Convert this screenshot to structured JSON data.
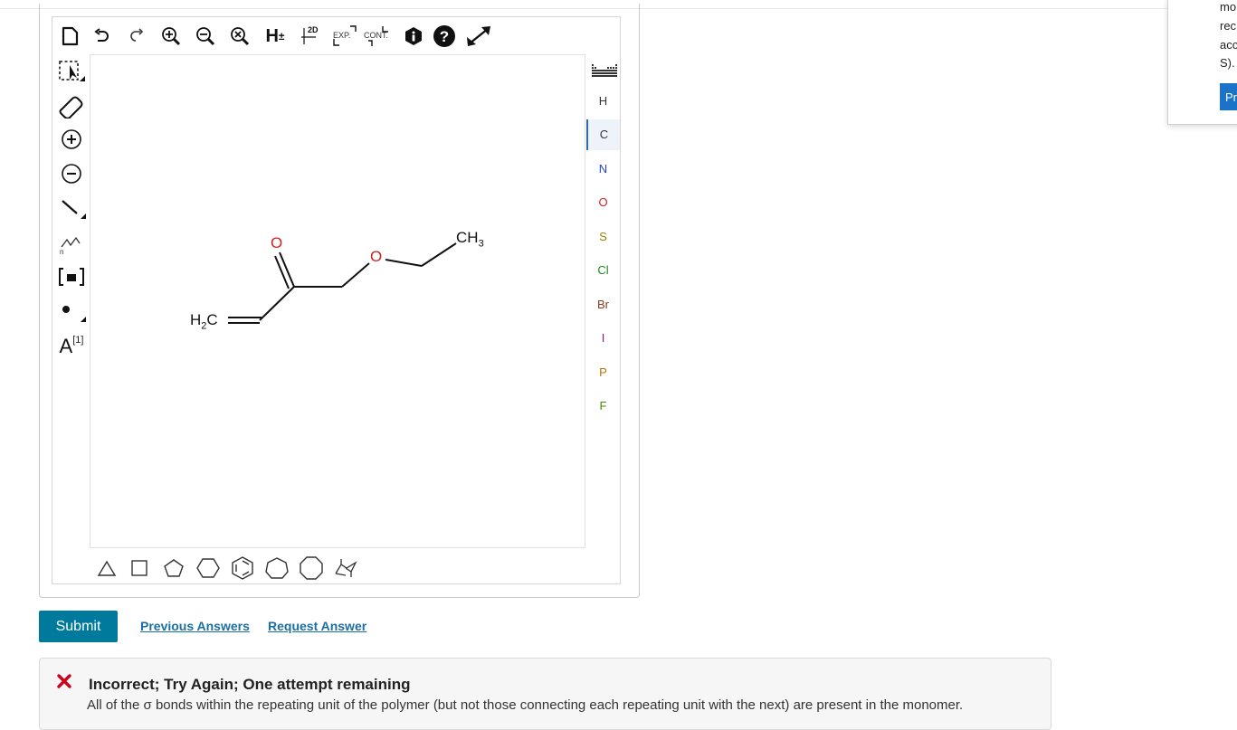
{
  "toolbar_top": {
    "icons": [
      "new-document-icon",
      "undo-icon",
      "redo-icon",
      "zoom-in-icon",
      "zoom-out-icon",
      "zoom-reset-icon",
      "explicit-hydrogens-icon",
      "clean-2d-icon",
      "expand-icon",
      "contract-icon",
      "info-icon",
      "help-icon",
      "fullscreen-icon"
    ],
    "h_label": "H",
    "h_sup": "±",
    "clean_label": "2D",
    "expand_label": "EXP.",
    "contract_label": "CONT."
  },
  "left_tools": {
    "icons": [
      "select-icon",
      "eraser-icon",
      "positive-charge-icon",
      "negative-charge-icon",
      "single-bond-icon",
      "chain-icon",
      "bracket-icon",
      "radical-icon",
      "atom-map-icon"
    ],
    "atom_map_label": "A",
    "atom_map_sup": "[1]"
  },
  "molecule": {
    "oxygen_carbonyl": "O",
    "oxygen_ether": "O",
    "methyl_label": "CH",
    "methyl_sub": "3",
    "vinyl_label": "H",
    "vinyl_sub": "2",
    "vinyl_label_end": "C"
  },
  "periodic": {
    "elements": [
      {
        "symbol": "H",
        "color": "#333333"
      },
      {
        "symbol": "C",
        "color": "#333333",
        "active": true
      },
      {
        "symbol": "N",
        "color": "#2244cc"
      },
      {
        "symbol": "O",
        "color": "#cc2222"
      },
      {
        "symbol": "S",
        "color": "#8a8a00"
      },
      {
        "symbol": "Cl",
        "color": "#1e8a1e"
      },
      {
        "symbol": "Br",
        "color": "#8a3a1a"
      },
      {
        "symbol": "I",
        "color": "#8a1a8a"
      },
      {
        "symbol": "P",
        "color": "#c07000"
      },
      {
        "symbol": "F",
        "color": "#4a8a00"
      }
    ]
  },
  "rings": [
    "cyclopropane-icon",
    "cyclobutane-icon",
    "cyclopentane-icon",
    "cyclohexane-icon",
    "benzene-icon",
    "cycloheptane-icon",
    "cyclooctane-icon",
    "chair-cyclohexane-icon"
  ],
  "actions": {
    "submit_label": "Submit",
    "previous_answers_label": "Previous Answers",
    "request_answer_label": "Request Answer"
  },
  "feedback": {
    "title": "Incorrect; Try Again; One attempt remaining",
    "message": "All of the σ bonds within the repeating unit of the polymer (but not those connecting each repeating unit with the next) are present in the monomer."
  },
  "side_panel": {
    "line1": "mo",
    "line2": "rec",
    "line3": "acc",
    "line4": "S).",
    "button_label": "Pr"
  },
  "colors": {
    "accent": "#007a9c",
    "link": "#1a6fa3",
    "error": "#d0021b",
    "oxygen": "#cc2222"
  }
}
